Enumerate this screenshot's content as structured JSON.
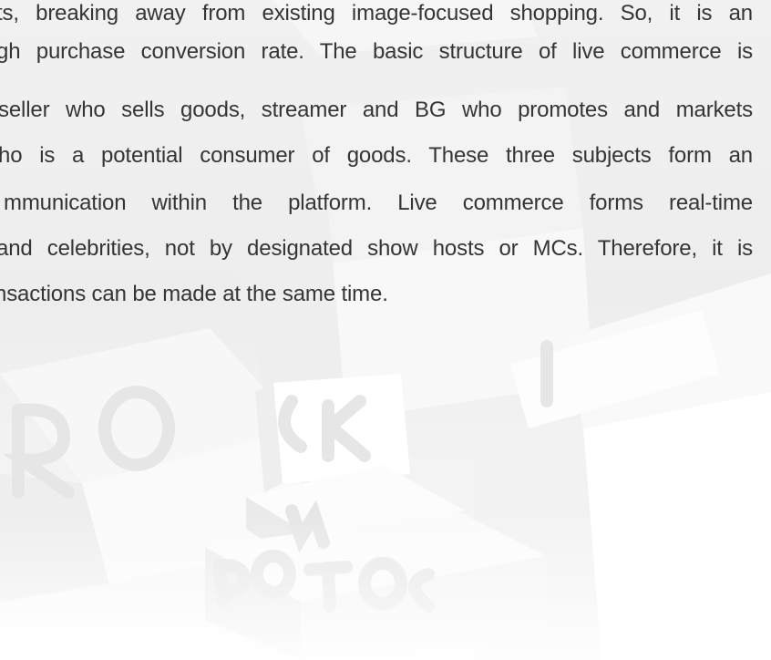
{
  "document": {
    "lines": [
      "ts, breaking away from existing image-focused shopping. So, it is an",
      "gh purchase conversion rate. The basic structure of live commerce is",
      "seller who sells goods, streamer and BG who promotes and markets",
      "ho is a potential consumer of goods. These three subjects form an",
      "mmunication within the platform. Live commerce forms real-time",
      "and celebrities, not by designated show hosts or MCs. Therefore, it is",
      "nsactions can be made at the same time."
    ]
  },
  "colors": {
    "text": "#353535",
    "background": "#efefef",
    "box_face": "#ffffff"
  }
}
